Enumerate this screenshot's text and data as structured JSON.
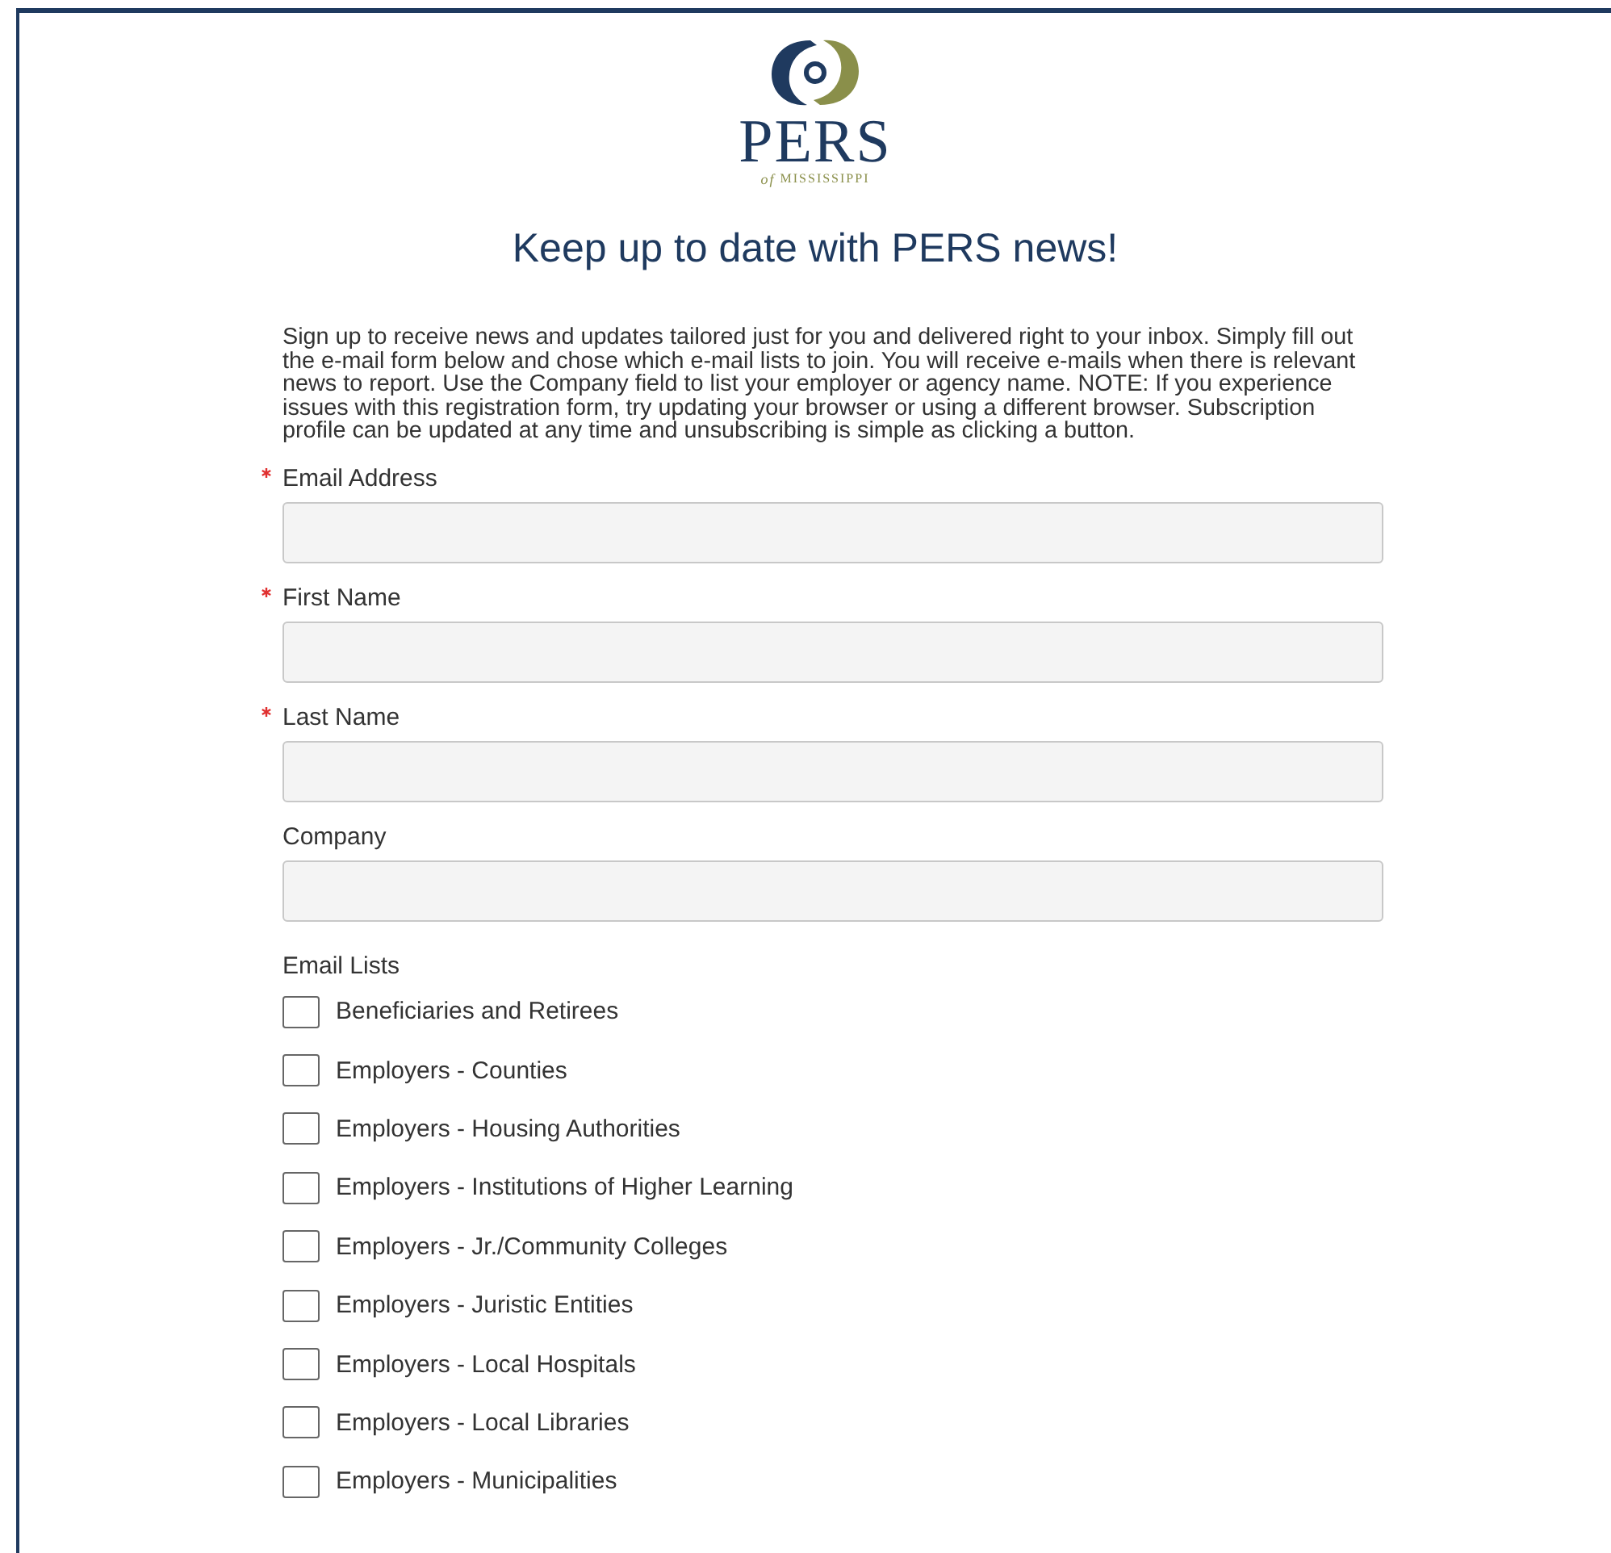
{
  "logo": {
    "name": "PERS",
    "tagline_prefix": "of",
    "tagline": "MISSISSIPPI"
  },
  "title": "Keep up to date with PERS news!",
  "intro": "Sign up to receive news and updates tailored just for you and delivered right to your inbox. Simply fill out the e-mail form below and chose which e-mail lists to join. You will receive e-mails when there is relevant news to report. Use the Company field to list your employer or agency name. NOTE: If you experience issues with this registration form, try updating your browser or using a different browser. Subscription profile can be updated at any time and unsubscribing is simple as clicking a button.",
  "fields": [
    {
      "label": "Email Address",
      "required": true
    },
    {
      "label": "First Name",
      "required": true
    },
    {
      "label": "Last Name",
      "required": true
    },
    {
      "label": "Company",
      "required": false
    }
  ],
  "email_lists": {
    "label": "Email Lists",
    "items": [
      {
        "label": "Beneficiaries and Retirees",
        "checked": false
      },
      {
        "label": "Employers - Counties",
        "checked": false
      },
      {
        "label": "Employers - Housing Authorities",
        "checked": false
      },
      {
        "label": "Employers - Institutions of Higher Learning",
        "checked": false
      },
      {
        "label": "Employers - Jr./Community Colleges",
        "checked": false
      },
      {
        "label": "Employers - Juristic Entities",
        "checked": false
      },
      {
        "label": "Employers - Local Hospitals",
        "checked": false
      },
      {
        "label": "Employers - Local Libraries",
        "checked": false
      },
      {
        "label": "Employers - Municipalities",
        "checked": false
      }
    ]
  }
}
